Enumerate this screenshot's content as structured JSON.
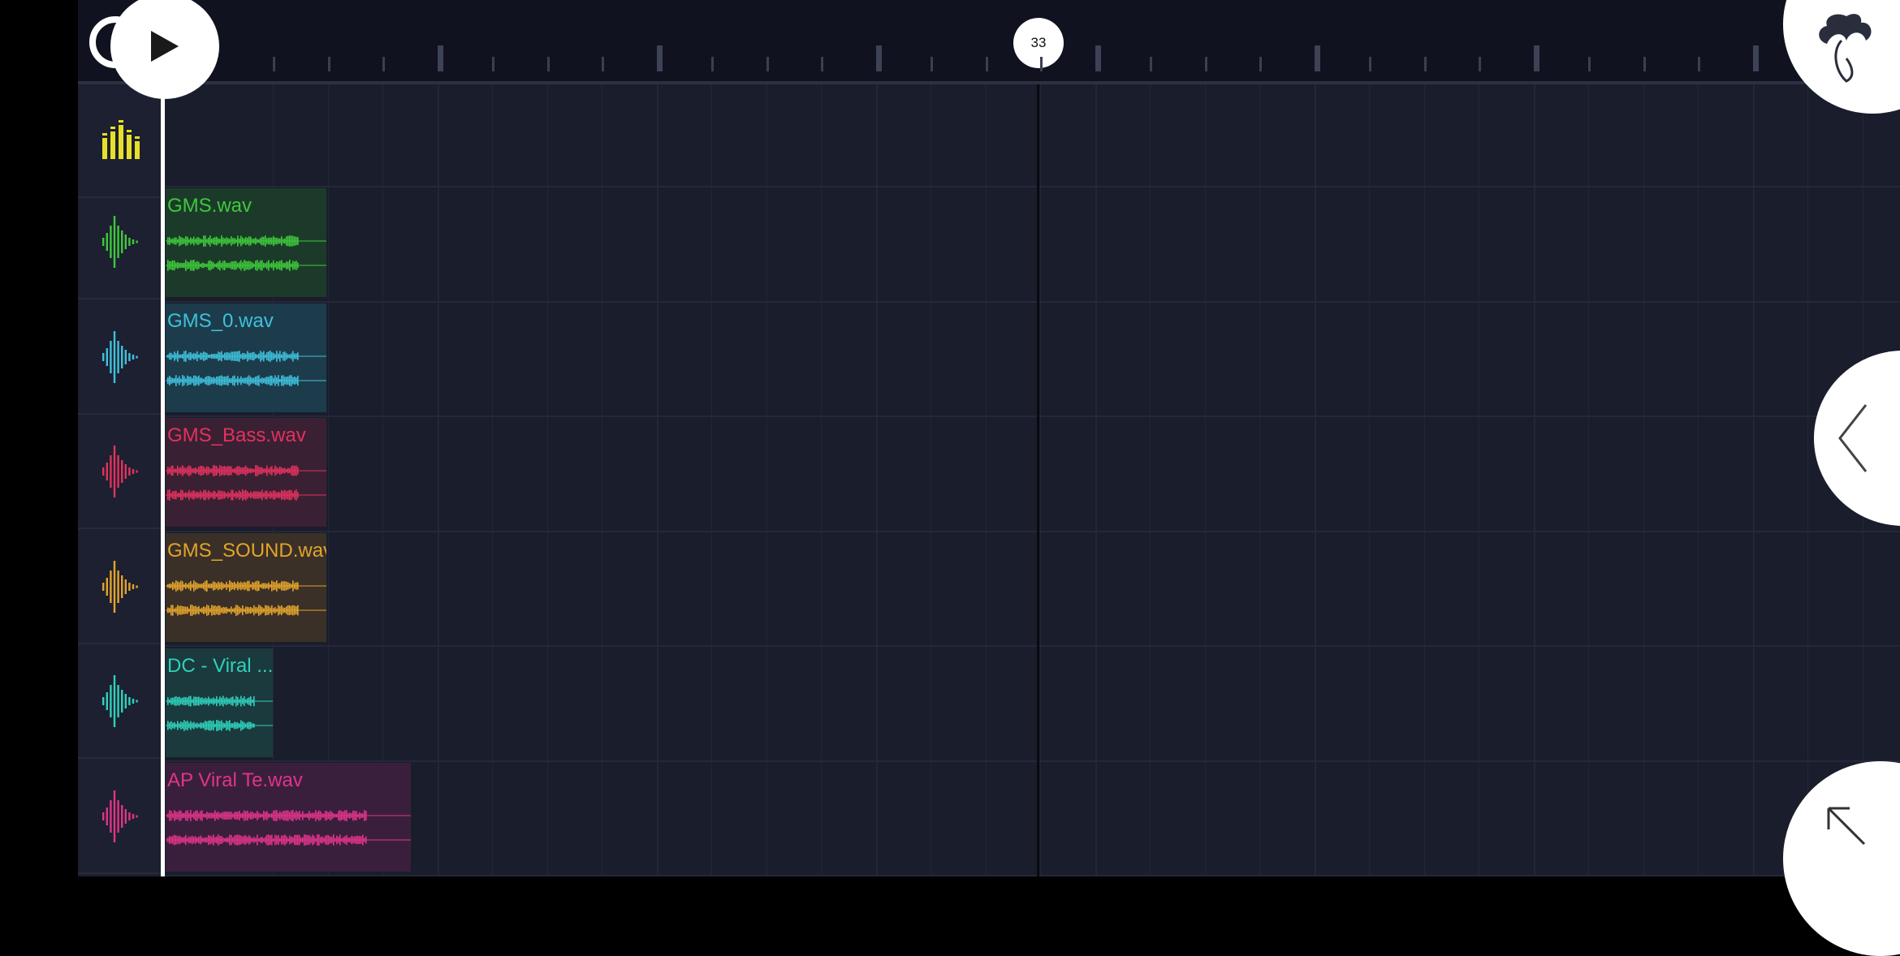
{
  "ruler": {
    "position_label": "33"
  },
  "tracks": [
    {
      "label": "GMS.wav",
      "color": "#3ec93b",
      "bg": "#1c3a2a"
    },
    {
      "label": "GMS_0.wav",
      "color": "#3fc1dc",
      "bg": "#1d3c4b"
    },
    {
      "label": "GMS_Bass.wav",
      "color": "#e2325e",
      "bg": "#3a2033"
    },
    {
      "label": "GMS_SOUND.wav",
      "color": "#e3a42c",
      "bg": "#3a3027"
    },
    {
      "label": "DC - Viral ...",
      "color": "#2fd1bb",
      "bg": "#1b3a3d"
    },
    {
      "label": "AP Viral Te.wav",
      "color": "#e03489",
      "bg": "#3a1f3d"
    }
  ],
  "icons": {
    "play": "play-icon",
    "mixer": "mixer-icon",
    "logo": "fl-studio-fruit-icon",
    "collapse": "chevron-left-icon",
    "expand": "arrow-up-left-icon"
  },
  "colors": {
    "mixer_icon": "#e6e02a",
    "background": "#1a1d2b"
  }
}
